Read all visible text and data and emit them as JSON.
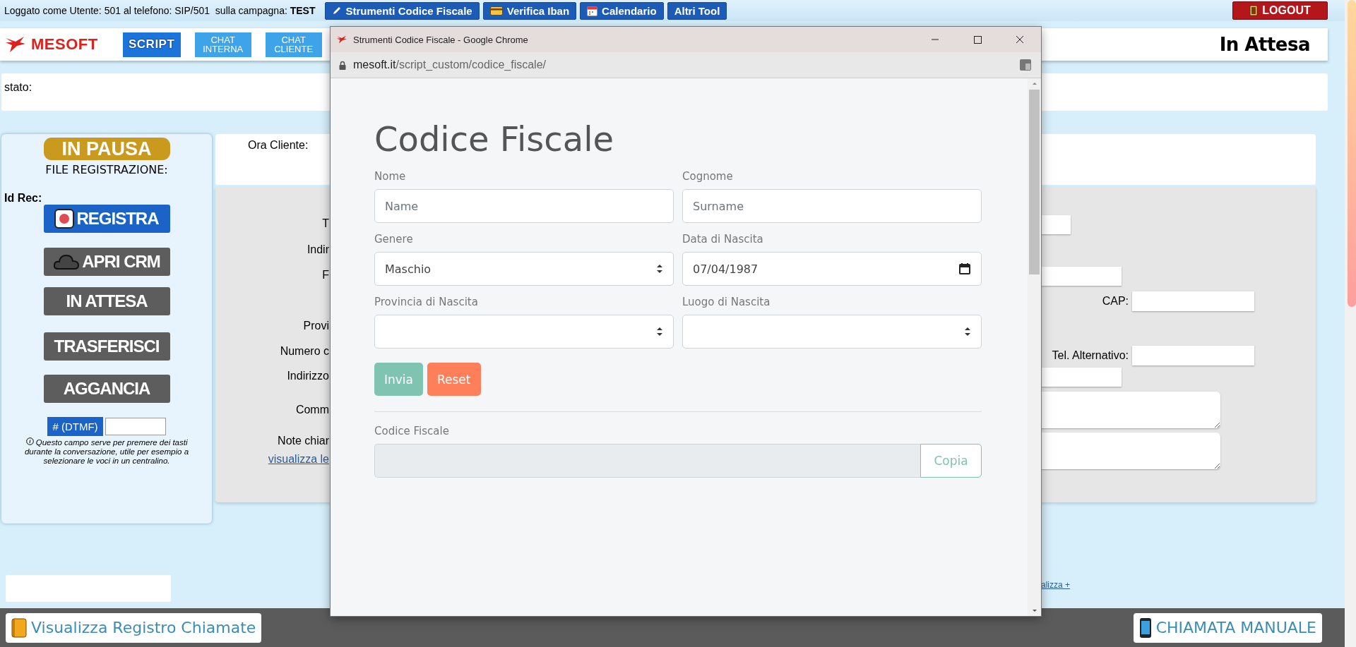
{
  "top_bar": {
    "login_text": "Loggato come Utente: 501 al telefono: SIP/501  sulla campagna: **TEST**",
    "tools": [
      {
        "label": "Strumenti Codice Fiscale"
      },
      {
        "label": "Verifica Iban"
      },
      {
        "label": "Calendario"
      },
      {
        "label": "Altri Tool"
      }
    ],
    "logout": "LOGOUT"
  },
  "header": {
    "logo": "MESOFT",
    "buttons": [
      {
        "label": "SCRIPT",
        "kind": "solid"
      },
      {
        "label": "CHAT INTERNA",
        "kind": "light"
      },
      {
        "label": "CHAT CLIENTE",
        "kind": "light"
      }
    ],
    "status": "In Attesa"
  },
  "stato_label": "stato:",
  "left_panel": {
    "badge": "IN PAUSA",
    "file_label": "FILE REGISTRAZIONE:",
    "id_label": "Id Rec:",
    "buttons": [
      {
        "label": "REGISTRA",
        "color": "#1b63c6"
      },
      {
        "label": "APRI CRM",
        "color": "#5d5d5d"
      },
      {
        "label": "IN ATTESA",
        "color": "#5d5d5d"
      },
      {
        "label": "TRASFERISCI",
        "color": "#5d5d5d"
      },
      {
        "label": "AGGANCIA",
        "color": "#5d5d5d"
      }
    ],
    "dtmf_button": "# (DTMF)",
    "dtmf_help": "Questo campo serve per premere dei tasti durante la conversazione, utile per esempio a selezionare le voci in un centralino."
  },
  "client_card": {
    "label": "Ora Cliente:"
  },
  "form": {
    "left_labels": [
      {
        "text": "T",
        "kind": "label"
      },
      {
        "text": "Indir",
        "kind": "label"
      },
      {
        "text": "F",
        "kind": "label"
      },
      {
        "text": "Provi",
        "kind": "label"
      },
      {
        "text": "Numero c",
        "kind": "label"
      },
      {
        "text": "Indirizzo",
        "kind": "label"
      },
      {
        "text": "Comm",
        "kind": "label"
      },
      {
        "text": "Note chiar",
        "kind": "label"
      },
      {
        "text": "visualizza le",
        "kind": "link"
      }
    ],
    "right_fields": [
      {
        "kind": "input"
      },
      {
        "kind": "input"
      },
      {
        "kind": "labeled",
        "label": "CAP:"
      },
      {
        "kind": "labeled",
        "label": "Tel. Alternativo:"
      },
      {
        "kind": "input"
      },
      {
        "kind": "textarea"
      },
      {
        "kind": "textarea"
      }
    ],
    "link": "alizza +"
  },
  "bottom_bar": {
    "left_button": "Visualizza Registro Chiamate",
    "right_button": "CHIAMATA MANUALE"
  },
  "popup": {
    "title": "Strumenti Codice Fiscale - Google Chrome",
    "url_host": "mesoft.it",
    "url_path": "/script_custom/codice_fiscale/",
    "heading": "Codice Fiscale",
    "fields": [
      {
        "label": "Nome",
        "kind": "text",
        "placeholder": "Name"
      },
      {
        "label": "Cognome",
        "kind": "text",
        "placeholder": "Surname"
      },
      {
        "label": "Genere",
        "kind": "select",
        "value": "Maschio"
      },
      {
        "label": "Data di Nascita",
        "kind": "date",
        "value": "07/04/1987"
      },
      {
        "label": "Provincia di Nascita",
        "kind": "select"
      },
      {
        "label": "Luogo di Nascita",
        "kind": "select"
      }
    ],
    "buttons": [
      {
        "label": "Invia",
        "color": "#7ec4b1"
      },
      {
        "label": "Reset",
        "color": "#ff7f5a"
      }
    ],
    "result": {
      "label": "Codice Fiscale",
      "button": "Copia"
    }
  }
}
